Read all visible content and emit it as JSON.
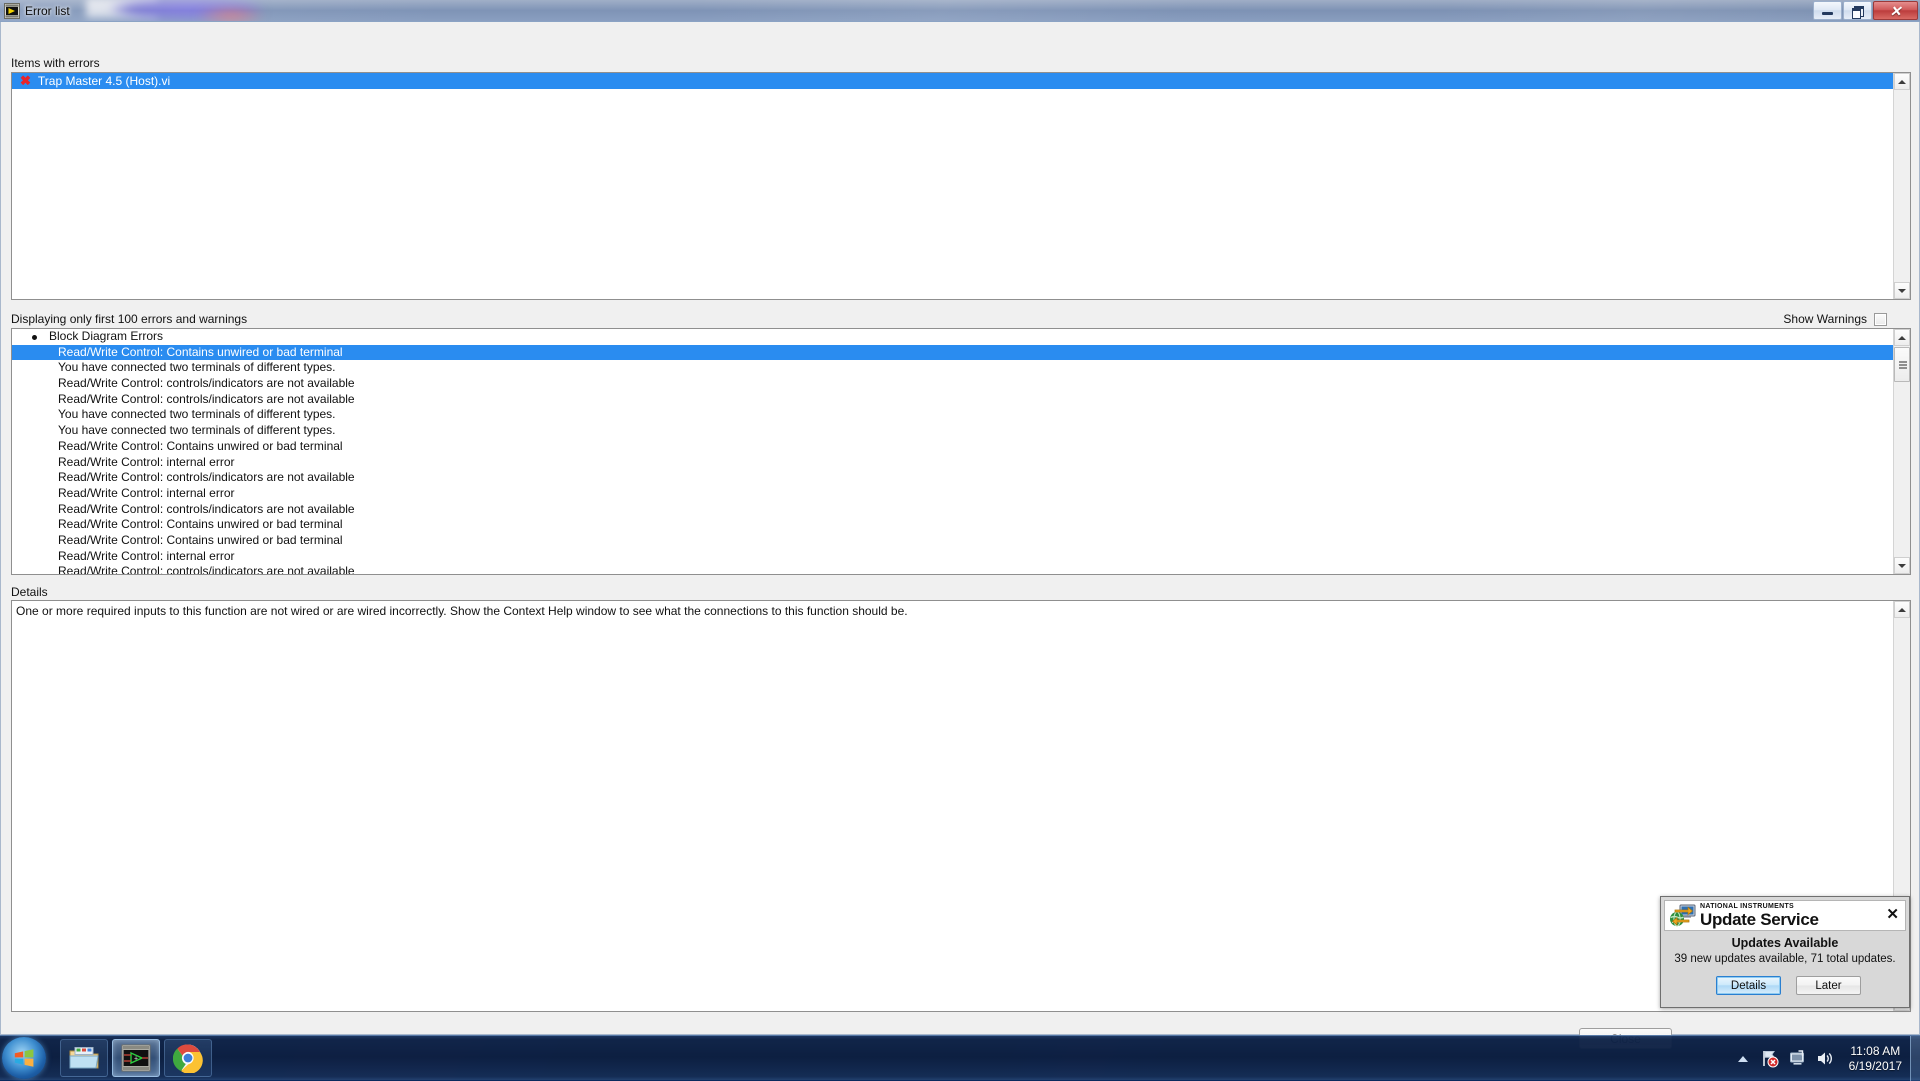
{
  "window": {
    "title": "Error list",
    "icon": "labview-vi-icon",
    "controls": {
      "minimize": "minimize-button",
      "restore": "restore-button",
      "close": "close-button"
    }
  },
  "items_section": {
    "label": "Items with errors",
    "items": [
      {
        "icon": "error-x-icon",
        "label": "Trap Master 4.5 (Host).vi",
        "selected": true
      }
    ]
  },
  "status": {
    "displaying_text": "Displaying only first 100 errors and warnings",
    "show_warnings_label": "Show Warnings",
    "show_warnings_checked": false
  },
  "errors_section": {
    "group_label": "Block Diagram Errors",
    "rows": [
      {
        "text": "Read/Write Control: Contains unwired or bad terminal",
        "selected": true
      },
      {
        "text": "You have connected two terminals of different types.",
        "selected": false
      },
      {
        "text": "Read/Write Control: controls/indicators are not available",
        "selected": false
      },
      {
        "text": "Read/Write Control: controls/indicators are not available",
        "selected": false
      },
      {
        "text": "You have connected two terminals of different types.",
        "selected": false
      },
      {
        "text": "You have connected two terminals of different types.",
        "selected": false
      },
      {
        "text": "Read/Write Control: Contains unwired or bad terminal",
        "selected": false
      },
      {
        "text": "Read/Write Control: internal error",
        "selected": false
      },
      {
        "text": "Read/Write Control: controls/indicators are not available",
        "selected": false
      },
      {
        "text": "Read/Write Control: internal error",
        "selected": false
      },
      {
        "text": "Read/Write Control: controls/indicators are not available",
        "selected": false
      },
      {
        "text": "Read/Write Control: Contains unwired or bad terminal",
        "selected": false
      },
      {
        "text": "Read/Write Control: Contains unwired or bad terminal",
        "selected": false
      },
      {
        "text": "Read/Write Control: internal error",
        "selected": false
      },
      {
        "text": "Read/Write Control: controls/indicators are not available",
        "selected": false
      }
    ]
  },
  "details_section": {
    "label": "Details",
    "text": "One or more required inputs to this function are not wired or are wired incorrectly. Show the Context Help window to see what the connections to this function should be."
  },
  "footer": {
    "close_label": "Close"
  },
  "popup": {
    "brand_small": "NATIONAL INSTRUMENTS",
    "brand_title": "Update Service",
    "heading": "Updates Available",
    "subtext": "39 new updates available, 71 total updates.",
    "details_label": "Details",
    "later_label": "Later",
    "close_glyph": "✕",
    "accent_color": "#2a7fd0"
  },
  "taskbar": {
    "start": "start-orb",
    "items": [
      {
        "name": "windows-explorer",
        "active": false
      },
      {
        "name": "labview",
        "active": true
      },
      {
        "name": "google-chrome",
        "active": false
      }
    ],
    "tray": {
      "network_icon": "network-error-icon",
      "action_center_icon": "action-center-icon",
      "volume_icon": "volume-icon",
      "time": "11:08 AM",
      "date": "6/19/2017"
    }
  },
  "colors": {
    "selection_blue": "#2a8cf0",
    "error_red": "#e8232a",
    "window_bg": "#f0f0f0",
    "taskbar_blue": "#0c1e40"
  }
}
